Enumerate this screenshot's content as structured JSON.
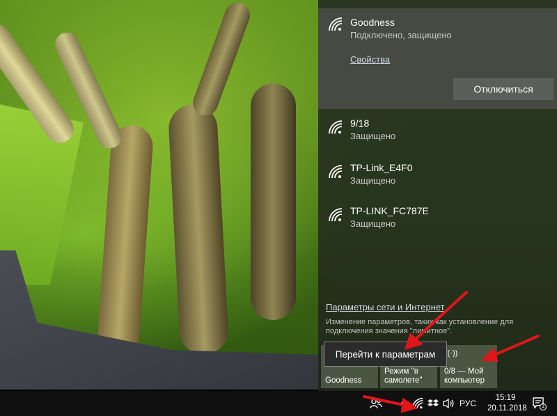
{
  "flyout": {
    "connected": {
      "name": "Goodness",
      "status": "Подключено, защищено",
      "properties_link": "Свойства",
      "disconnect_label": "Отключиться"
    },
    "networks": [
      {
        "name": "9/18",
        "status": "Защищено"
      },
      {
        "name": "TP-Link_E4F0",
        "status": "Защищено"
      },
      {
        "name": "TP-LINK_FC787E",
        "status": "Защищено"
      }
    ],
    "settings_link": "Параметры сети и Интернет",
    "settings_desc_line1": "Изменение параметров, таких как установление для",
    "settings_desc_line2": "подключения значения \"лимитное\".",
    "tiles": [
      {
        "line1": "",
        "line2": "Goodness"
      },
      {
        "line1": "Режим \"в",
        "line2": "самолете\""
      },
      {
        "line1": "0/8 — Мой",
        "line2": "компьютер"
      }
    ]
  },
  "tooltip": {
    "label": "Перейти к параметрам"
  },
  "taskbar": {
    "language": "РУС",
    "time": "15:19",
    "date": "20.11.2018",
    "notification_count": "1"
  },
  "colors": {
    "flyout_bg": "#263022",
    "connected_bg": "#50524e",
    "button_bg": "#5c5e5a",
    "arrow": "#e0161b",
    "taskbar_bg": "#101010"
  },
  "icons": [
    "wifi-icon",
    "people-icon",
    "chevron-up-icon",
    "dropbox-icon",
    "volume-icon",
    "notification-icon"
  ]
}
